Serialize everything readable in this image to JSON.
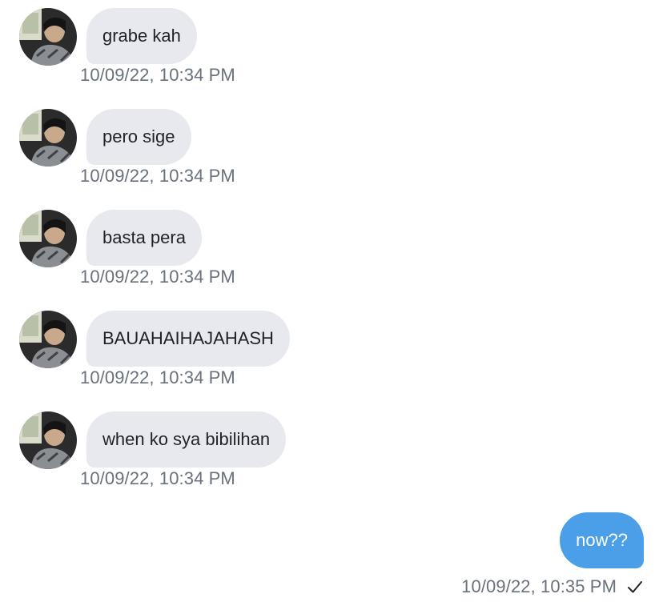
{
  "messages": [
    {
      "text": "grabe kah",
      "time": "10/09/22, 10:34 PM"
    },
    {
      "text": "pero sige",
      "time": "10/09/22, 10:34 PM"
    },
    {
      "text": "basta pera",
      "time": "10/09/22, 10:34 PM"
    },
    {
      "text": "BAUAHAIHAJAHASH",
      "time": "10/09/22, 10:34 PM"
    },
    {
      "text": "when ko sya bibilihan",
      "time": "10/09/22, 10:34 PM"
    }
  ],
  "sent": {
    "text": "now??",
    "time": "10/09/22, 10:35 PM",
    "status_icon": "check-icon"
  },
  "colors": {
    "incoming_bubble": "#e7e9ee",
    "outgoing_bubble": "#4a9fe8",
    "timestamp": "#69717d"
  }
}
